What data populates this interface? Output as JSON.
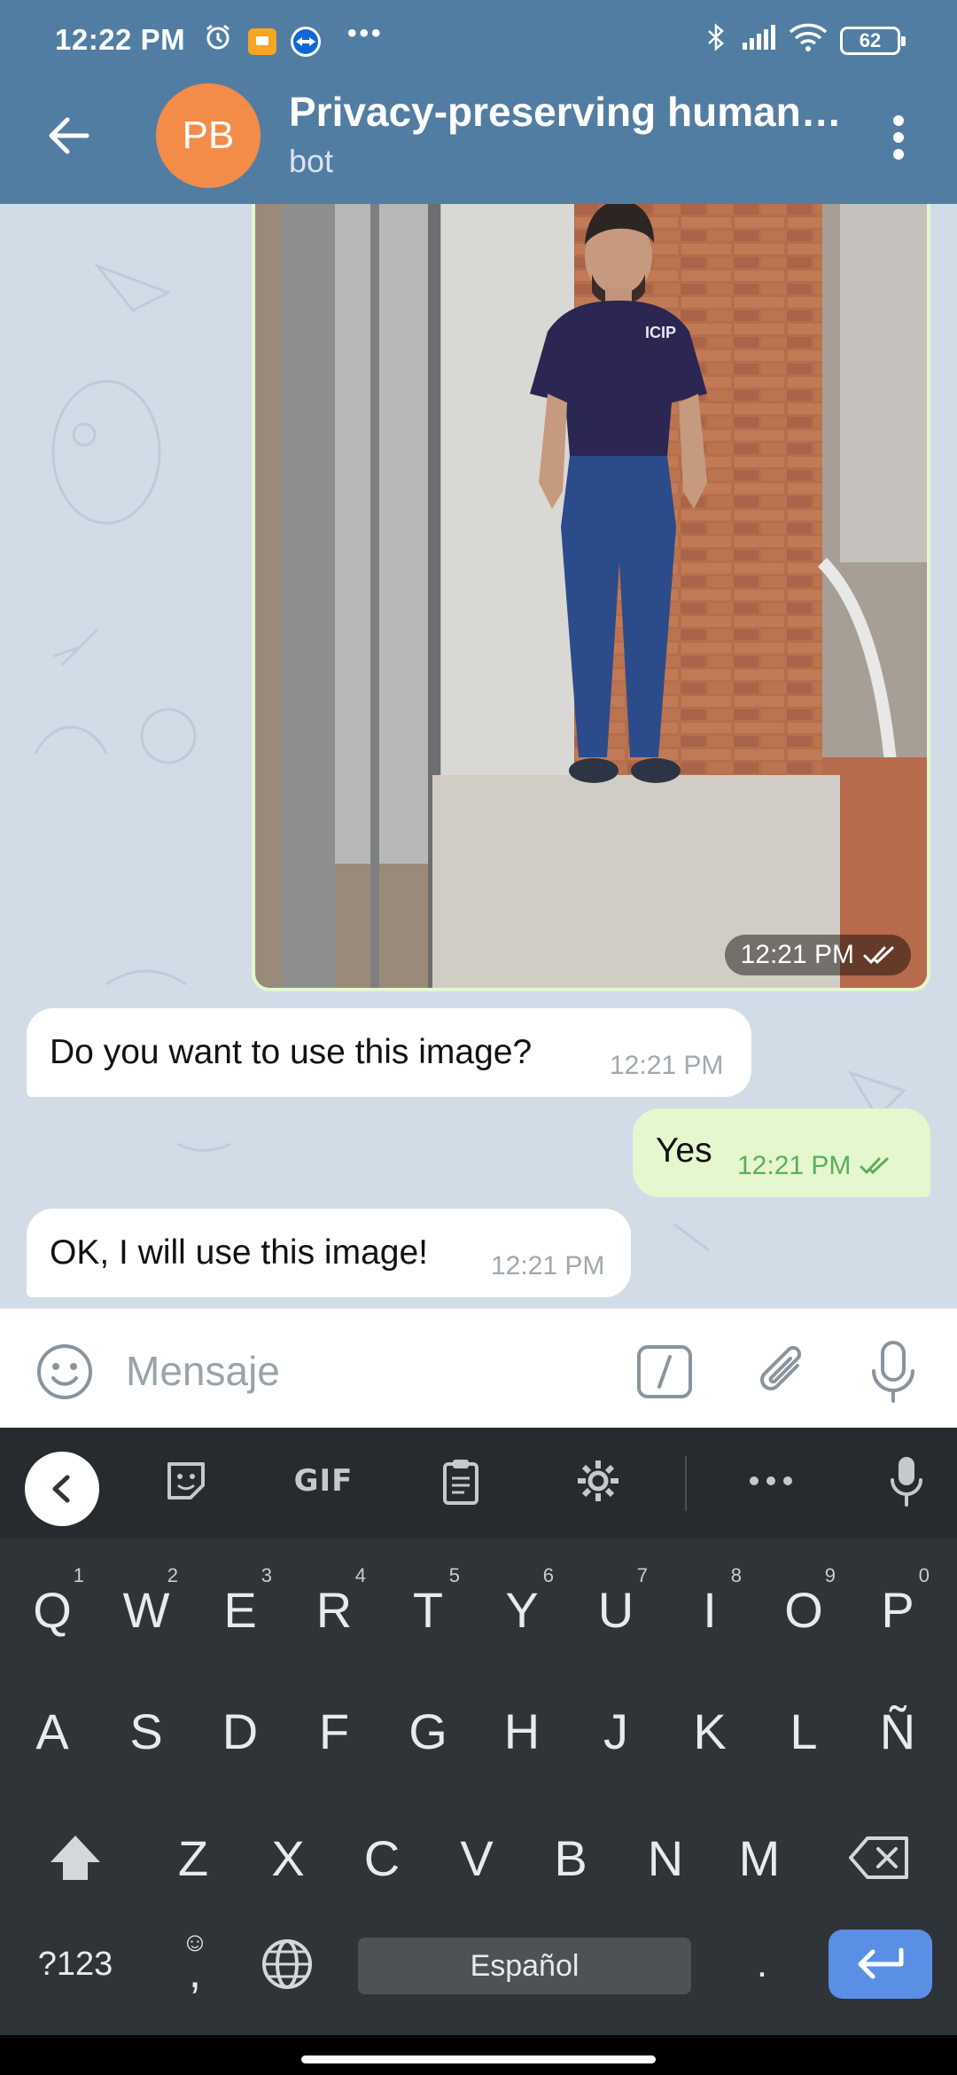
{
  "status_bar": {
    "time": "12:22 PM",
    "battery": "62",
    "more": "•••"
  },
  "header": {
    "avatar_initials": "PB",
    "title": "Privacy-preserving human…",
    "subtitle": "bot"
  },
  "messages": [
    {
      "type": "photo",
      "direction": "outgoing",
      "time": "12:21 PM",
      "status": "read"
    },
    {
      "type": "text",
      "direction": "incoming",
      "text": "Do you want to use this image?",
      "time": "12:21 PM"
    },
    {
      "type": "text",
      "direction": "outgoing",
      "text": "Yes",
      "time": "12:21 PM",
      "status": "read"
    },
    {
      "type": "text",
      "direction": "incoming",
      "text": "OK, I will use this image!",
      "time": "12:21 PM"
    }
  ],
  "input": {
    "placeholder": "Mensaje",
    "value": ""
  },
  "keyboard": {
    "toolbar": {
      "gif_label": "GIF"
    },
    "row1": [
      {
        "key": "Q",
        "hint": "1"
      },
      {
        "key": "W",
        "hint": "2"
      },
      {
        "key": "E",
        "hint": "3"
      },
      {
        "key": "R",
        "hint": "4"
      },
      {
        "key": "T",
        "hint": "5"
      },
      {
        "key": "Y",
        "hint": "6"
      },
      {
        "key": "U",
        "hint": "7"
      },
      {
        "key": "I",
        "hint": "8"
      },
      {
        "key": "O",
        "hint": "9"
      },
      {
        "key": "P",
        "hint": "0"
      }
    ],
    "row2": [
      "A",
      "S",
      "D",
      "F",
      "G",
      "H",
      "J",
      "K",
      "L",
      "Ñ"
    ],
    "row3": [
      "Z",
      "X",
      "C",
      "V",
      "B",
      "N",
      "M"
    ],
    "symbols_label": "?123",
    "comma_label": ",",
    "space_label": "Español",
    "period_label": "."
  },
  "colors": {
    "header": "#527da3",
    "chat_bg": "#d2dce6",
    "outgoing_bubble": "#e4f7cf",
    "incoming_bubble": "#ffffff",
    "avatar": "#f28c48",
    "read_check": "#5dae5a",
    "keyboard_bg": "#2f3438",
    "enter_key": "#5b8fe6"
  }
}
